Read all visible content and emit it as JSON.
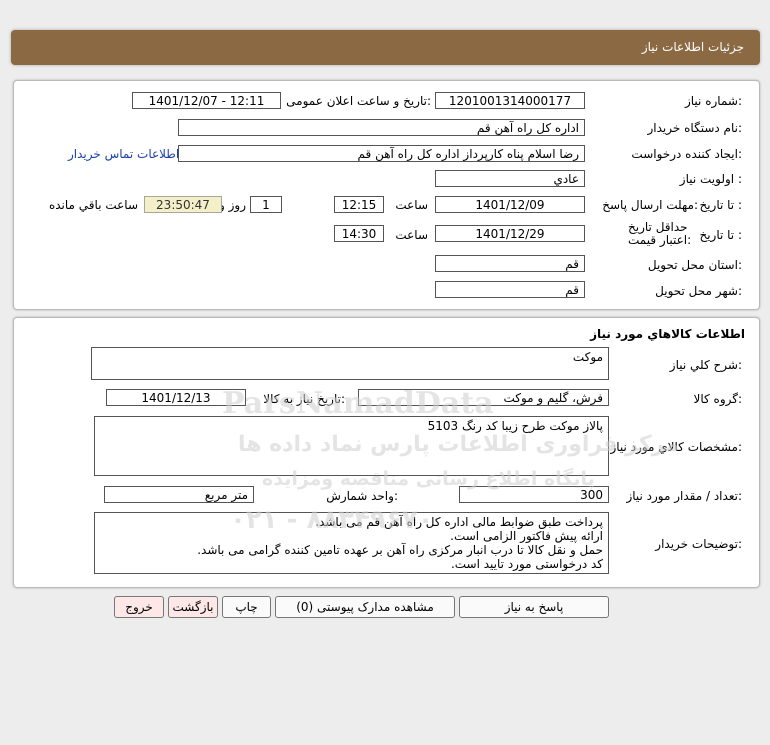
{
  "header": {
    "title": "جزئیات اطلاعات نیاز"
  },
  "info": {
    "need_number_label": "شماره نیاز:",
    "need_number": "1201001314000177",
    "announce_label": "تاریخ و ساعت اعلان عمومی:",
    "announce_value": "1401/12/07 - 12:11",
    "buyer_org_label": "نام دستگاه خریدار:",
    "buyer_org": "اداره کل  راه آهن قم",
    "creator_label": "ایجاد کننده درخواست:",
    "creator": "رضا اسلام پناه کارپرداز اداره کل  راه آهن قم",
    "contact_link": "اطلاعات تماس خریدار",
    "priority_label": "اولویت نیاز :",
    "priority": "عادي",
    "deadline_label": "مهلت ارسال پاسخ:",
    "to_date_label": "تا تاریخ :",
    "deadline_date": "1401/12/09",
    "time_label": "ساعت",
    "deadline_time": "12:15",
    "days_value": "1",
    "days_label": "روز و",
    "remaining_value": "23:50:47",
    "remaining_label": "ساعت باقي مانده",
    "validity_label": "حداقل تاریخ اعتبار قیمت:",
    "validity_to_label": "تا تاریخ :",
    "validity_date": "1401/12/29",
    "validity_time_label": "ساعت",
    "validity_time": "14:30",
    "province_label": "استان محل تحویل:",
    "province": "قم",
    "city_label": "شهر محل تحویل:",
    "city": "قم"
  },
  "goods": {
    "title": "اطلاعات کالاهاي مورد نياز",
    "desc_label": "شرح کلي نياز:",
    "desc": "موکت",
    "group_label": "گروه کالا:",
    "group": "فرش، گلیم و موکت",
    "need_date_label": "تاریخ نیاز به کالا:",
    "need_date": "1401/12/13",
    "spec_label": "مشخصات کالاي مورد نياز:",
    "spec": "پالاز موکت طرح زیبا کد رنگ 5103",
    "qty_label": "تعداد / مقدار مورد نیاز:",
    "qty": "300",
    "unit_label": "واحد شمارش:",
    "unit": "متر مربع",
    "notes_label": "توضیحات خریدار:",
    "notes": [
      "پرداخت طبق ضوابط مالی اداره کل راه آهن قم می باشد.",
      "ارائه پیش فاکتور الزامی است.",
      "حمل و نقل کالا تا درب انبار مرکزی راه آهن بر عهده تامین کننده گرامی می باشد.",
      "کد درخواستی مورد تایید است."
    ]
  },
  "buttons": {
    "reply": "پاسخ به نیاز",
    "attachments": "مشاهده مدارک پیوستی (0)",
    "print": "چاپ",
    "back": "بازگشت",
    "exit": "خروج"
  },
  "watermark": {
    "brand": "ParsNamadData",
    "line1": "مرکز فراوری اطلاعات پارس نماد داده ها",
    "line2": "پایگاه اطلاع رسانی مناقصه ومزایده",
    "phone": "۰۲۱ - ۸۸۳۴۹۶۷۰"
  }
}
